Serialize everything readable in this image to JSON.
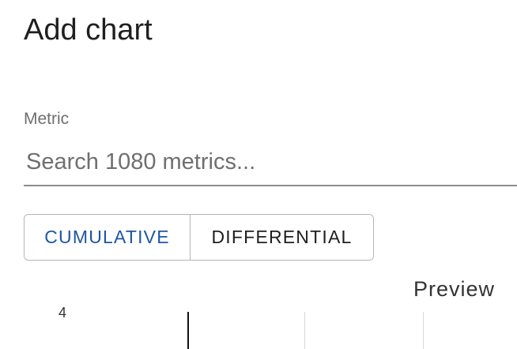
{
  "dialog": {
    "title": "Add chart"
  },
  "metric": {
    "label": "Metric",
    "placeholder": "Search 1080 metrics...",
    "value": ""
  },
  "mode_toggle": {
    "options": [
      {
        "label": "CUMULATIVE",
        "selected": true
      },
      {
        "label": "DIFFERENTIAL",
        "selected": false
      }
    ],
    "selected_color": "#1e55a6"
  },
  "preview": {
    "title": "Preview",
    "tick_labels": [
      "4"
    ]
  }
}
